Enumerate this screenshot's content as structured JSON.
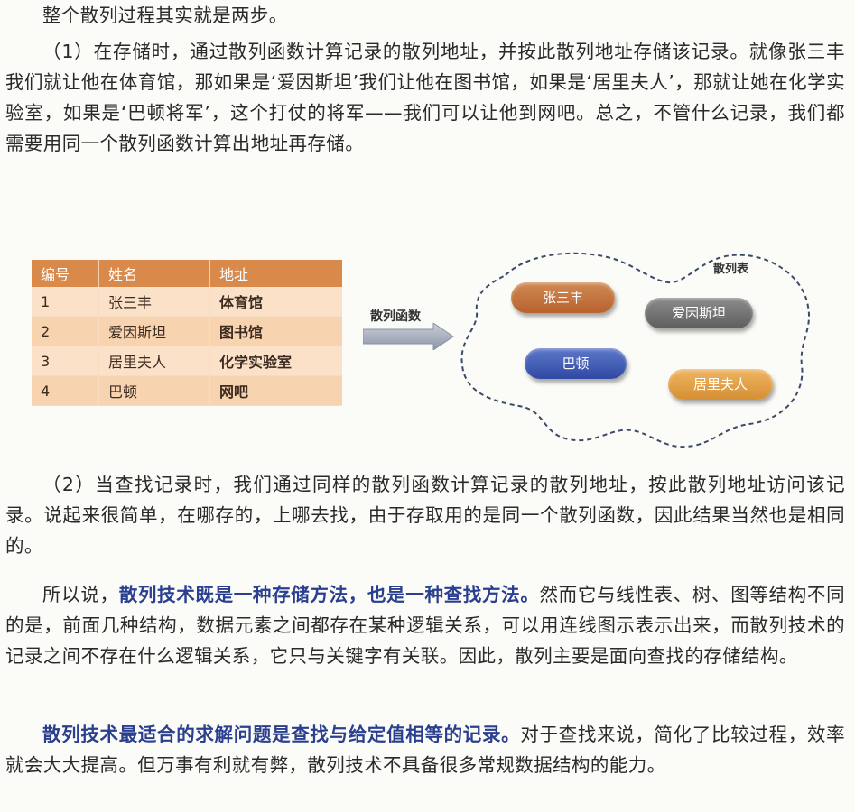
{
  "paragraphs": {
    "p0": "整个散列过程其实就是两步。",
    "p1": "（1）在存储时，通过散列函数计算记录的散列地址，并按此散列地址存储该记录。就像张三丰我们就让他在体育馆，那如果是‘爱因斯坦’我们让他在图书馆，如果是‘居里夫人’，那就让她在化学实验室，如果是‘巴顿将军’，这个打仗的将军——我们可以让他到网吧。总之，不管什么记录，我们都需要用同一个散列函数计算出地址再存储。",
    "p2": "（2）当查找记录时，我们通过同样的散列函数计算记录的散列地址，按此散列地址访问该记录。说起来很简单，在哪存的，上哪去找，由于存取用的是同一个散列函数，因此结果当然也是相同的。",
    "p3_a": "所以说，",
    "p3_hl": "散列技术既是一种存储方法，也是一种查找方法。",
    "p3_b": "然而它与线性表、树、图等结构不同的是，前面几种结构，数据元素之间都存在某种逻辑关系，可以用连线图示表示出来，而散列技术的记录之间不存在什么逻辑关系，它只与关键字有关联。因此，散列主要是面向查找的存储结构。",
    "p4_hl": "散列技术最适合的求解问题是查找与给定值相等的记录。",
    "p4_b": "对于查找来说，简化了比较过程，效率就会大大提高。但万事有利就有弊，散列技术不具备很多常规数据结构的能力。"
  },
  "table": {
    "headers": [
      "编号",
      "姓名",
      "地址"
    ],
    "rows": [
      [
        "1",
        "张三丰",
        "体育馆"
      ],
      [
        "2",
        "爱因斯坦",
        "图书馆"
      ],
      [
        "3",
        "居里夫人",
        "化学实验室"
      ],
      [
        "4",
        "巴顿",
        "网吧"
      ]
    ]
  },
  "diagram": {
    "function_label": "散列函数",
    "hash_table_label": "散列表",
    "pills": [
      "张三丰",
      "爱因斯坦",
      "巴顿",
      "居里夫人"
    ]
  },
  "colors": {
    "highlight": "#2a3f8f",
    "table_header": "#d9894a"
  }
}
